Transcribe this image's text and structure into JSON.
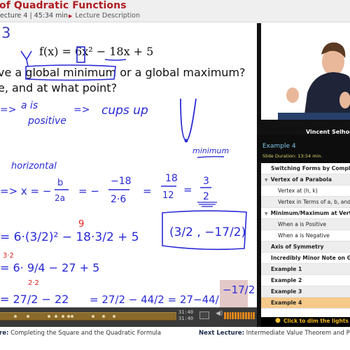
{
  "header": {
    "title": "of Quadratic Functions",
    "subtitle_lecture": "ecture 4",
    "subtitle_sep": " | ",
    "subtitle_duration": "45:34 min",
    "lecture_description": "Lecture Description"
  },
  "slide": {
    "example_number": "3",
    "function": "f(x) = 6x² − 18x + 5",
    "question_line1": "ve a global minimum or a global maximum?",
    "question_line2": "e, and at what point?",
    "handwriting": {
      "line1_arrow": "=>",
      "a_is": "a is",
      "positive": "positive",
      "arrow2": "=>",
      "cups_up": "cups up",
      "minimum": "minimum",
      "horizontal": "horizontal",
      "x_eq": "=> x = −",
      "b": "b",
      "two_a": "2a",
      "eq1": "= −",
      "neg18": "−18",
      "two_dot_six": "2·6",
      "eq2": "=",
      "n18": "18",
      "n12": "12",
      "eq3": "=",
      "three": "3",
      "two": "2",
      "row1": "= 6·(3/2)² − 18·3/2 + 5",
      "red_9": "9",
      "vertex_point": "(3/2 , −17/2)",
      "red_3x2": "3·2",
      "row2": "= 6· 9/4 − 27 + 5",
      "red_2x2": "2·2",
      "row3_a": "= 27/2 − 22",
      "row3_b": "= 27/2 − 44/2 = 27−44/2 =",
      "answer": "−17/2"
    }
  },
  "controls": {
    "time_current": "31:40",
    "time_total": "31:40",
    "volume_level": 1.0,
    "progress_fraction": 1.0,
    "chapter_markers": 10
  },
  "video": {
    "presenter_name": "Vincent Selhorst-Jones"
  },
  "current_slide": {
    "name": "Example 4",
    "duration": "Slide Duration: 13:54 min."
  },
  "toc": {
    "items": [
      {
        "label": "Switching Forms by Completing the Square",
        "type": "bold"
      },
      {
        "label": "Vertex of a Parabola",
        "type": "section"
      },
      {
        "label": "Vertex at (h, k)",
        "type": "sub"
      },
      {
        "label": "Vertex in Terms of a, b, and c Coefficients",
        "type": "sub"
      },
      {
        "label": "Minimum/Maximum at Vertex",
        "type": "section"
      },
      {
        "label": "When a is Positive",
        "type": "sub"
      },
      {
        "label": "When a is Negative",
        "type": "sub"
      },
      {
        "label": "Axis of Symmetry",
        "type": "bold"
      },
      {
        "label": "Incredibly Minor Note on Grammar",
        "type": "bold"
      },
      {
        "label": "Example 1",
        "type": "bold"
      },
      {
        "label": "Example 2",
        "type": "bold"
      },
      {
        "label": "Example 3",
        "type": "bold"
      },
      {
        "label": "Example 4",
        "type": "bold",
        "active": true
      }
    ],
    "dim_lights": "Click to dim the lights"
  },
  "footer": {
    "prev_label": "re:",
    "prev_title": "Completing the Square and the Quadratic Formula",
    "next_label": "Next Lecture:",
    "next_title": "Intermediate Value Theorem and Polynomial Division"
  },
  "colors": {
    "title_red": "#b01c22",
    "ink_blue": "#2a2ad6",
    "ink_red": "#e0211d",
    "active_toc": "#f5c98a",
    "progress": "#8a6a2a",
    "volume": "#e2871a"
  }
}
